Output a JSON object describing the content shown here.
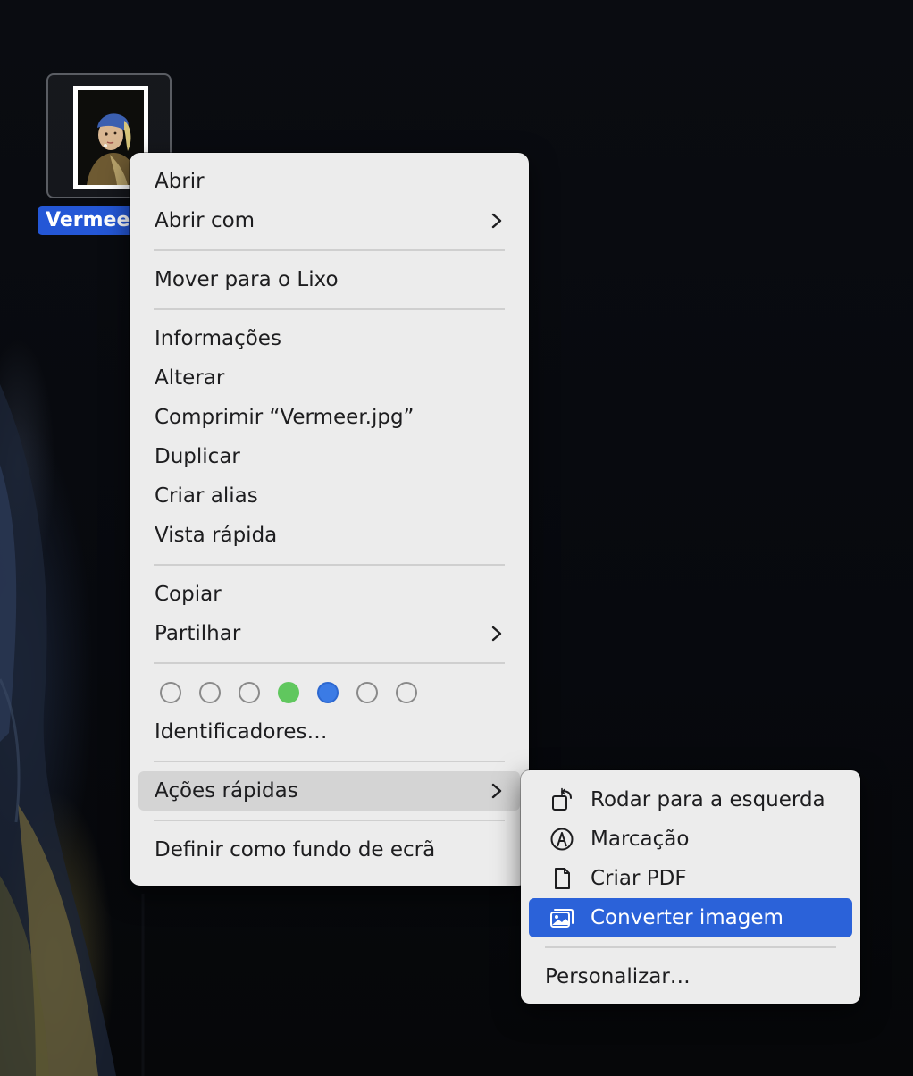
{
  "desktop": {
    "file_name": "Vermeer.jpg",
    "file_label": "Vermeer"
  },
  "context_menu": {
    "open": "Abrir",
    "open_with": "Abrir com",
    "move_to_trash": "Mover para o Lixo",
    "get_info": "Informações",
    "rename": "Alterar",
    "compress": "Comprimir “Vermeer.jpg”",
    "duplicate": "Duplicar",
    "make_alias": "Criar alias",
    "quick_look": "Vista rápida",
    "copy": "Copiar",
    "share": "Partilhar",
    "tags": [
      {
        "color": "none"
      },
      {
        "color": "none"
      },
      {
        "color": "none"
      },
      {
        "color": "#60c75e"
      },
      {
        "color": "#3b7be5"
      },
      {
        "color": "none"
      },
      {
        "color": "none"
      }
    ],
    "tags_item": "Identificadores…",
    "quick_actions": "Ações rápidas",
    "set_wallpaper": "Definir como fundo de ecrã"
  },
  "quick_actions_menu": {
    "items": [
      {
        "label": "Rodar para a esquerda",
        "icon": "rotate-left-icon"
      },
      {
        "label": "Marcação",
        "icon": "markup-icon"
      },
      {
        "label": "Criar PDF",
        "icon": "document-icon"
      },
      {
        "label": "Converter imagem",
        "icon": "photos-icon",
        "selected": true
      }
    ],
    "customize": "Personalizar…"
  },
  "colors": {
    "selection_blue": "#2b62d9",
    "label_blue": "#2457d6",
    "menu_bg": "#ececec"
  }
}
